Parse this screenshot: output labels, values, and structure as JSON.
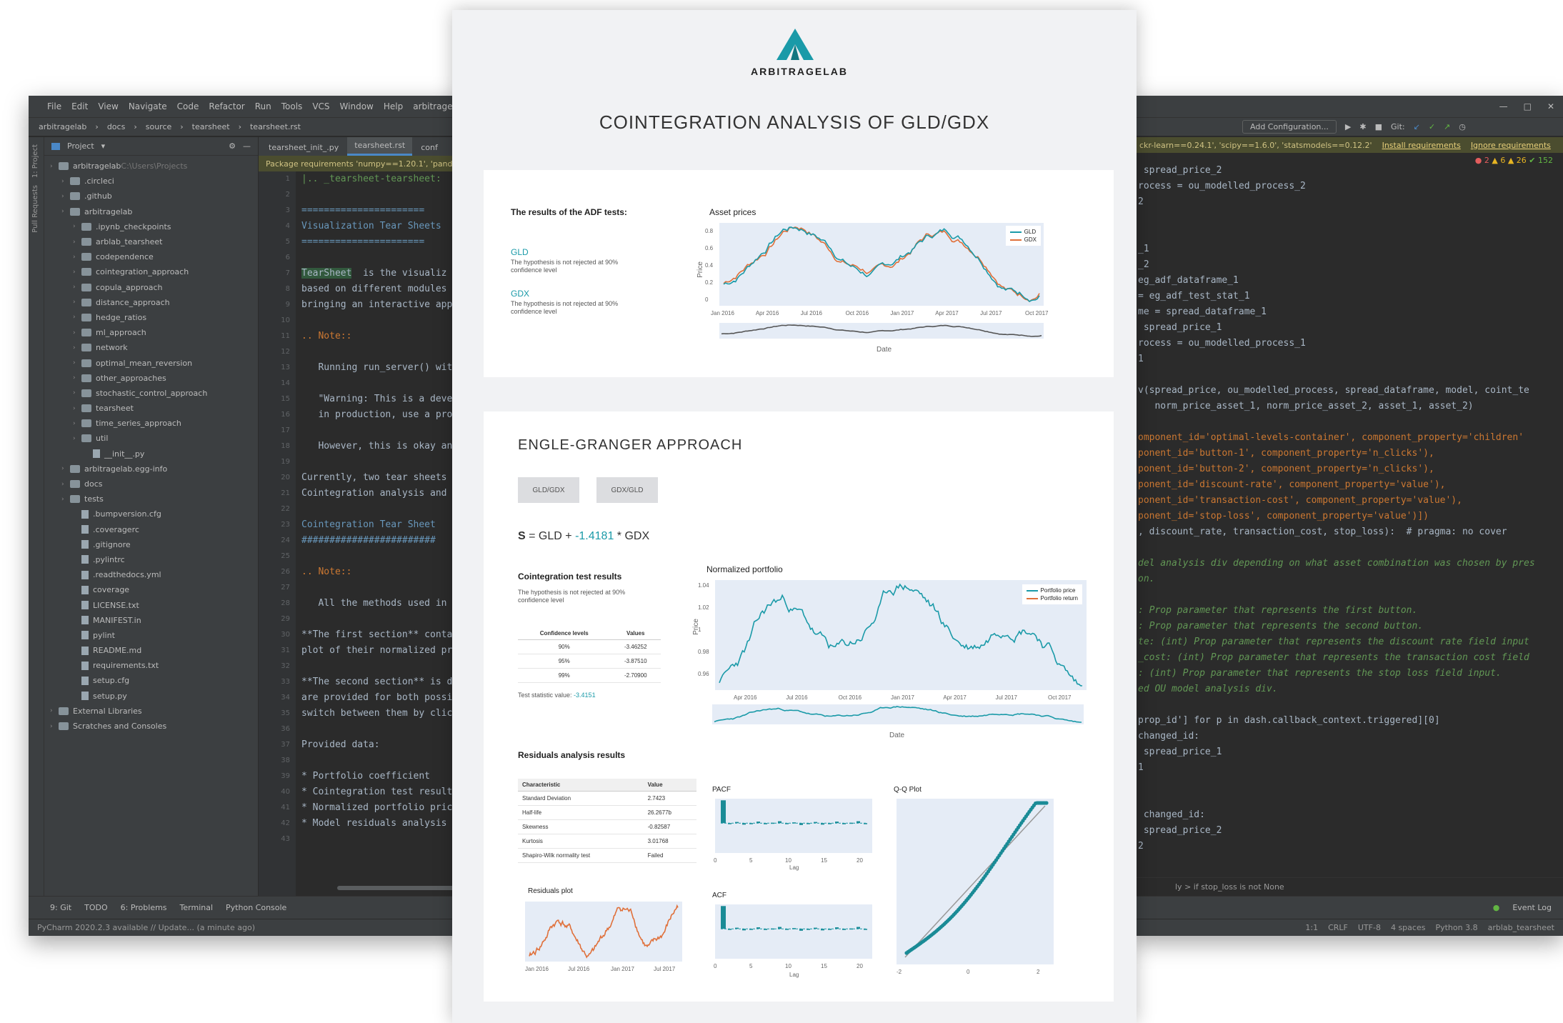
{
  "ide_left": {
    "menu": [
      "File",
      "Edit",
      "View",
      "Navigate",
      "Code",
      "Refactor",
      "Run",
      "Tools",
      "VCS",
      "Window",
      "Help",
      "arbitragelab"
    ],
    "breadcrumbs": [
      "arbitragelab",
      "docs",
      "source",
      "tearsheet",
      "tearsheet.rst"
    ],
    "project_header": "Project",
    "tree": [
      {
        "label": "arbitragelab",
        "kind": "folder",
        "depth": 0,
        "suffix": "C:\\Users\\Projects"
      },
      {
        "label": ".circleci",
        "kind": "folder",
        "depth": 1
      },
      {
        "label": ".github",
        "kind": "folder",
        "depth": 1
      },
      {
        "label": "arbitragelab",
        "kind": "folder",
        "depth": 1
      },
      {
        "label": ".ipynb_checkpoints",
        "kind": "folder",
        "depth": 2
      },
      {
        "label": "arblab_tearsheet",
        "kind": "folder",
        "depth": 2
      },
      {
        "label": "codependence",
        "kind": "folder",
        "depth": 2
      },
      {
        "label": "cointegration_approach",
        "kind": "folder",
        "depth": 2
      },
      {
        "label": "copula_approach",
        "kind": "folder",
        "depth": 2
      },
      {
        "label": "distance_approach",
        "kind": "folder",
        "depth": 2
      },
      {
        "label": "hedge_ratios",
        "kind": "folder",
        "depth": 2
      },
      {
        "label": "ml_approach",
        "kind": "folder",
        "depth": 2
      },
      {
        "label": "network",
        "kind": "folder",
        "depth": 2
      },
      {
        "label": "optimal_mean_reversion",
        "kind": "folder",
        "depth": 2
      },
      {
        "label": "other_approaches",
        "kind": "folder",
        "depth": 2
      },
      {
        "label": "stochastic_control_approach",
        "kind": "folder",
        "depth": 2
      },
      {
        "label": "tearsheet",
        "kind": "folder",
        "depth": 2
      },
      {
        "label": "time_series_approach",
        "kind": "folder",
        "depth": 2
      },
      {
        "label": "util",
        "kind": "folder",
        "depth": 2
      },
      {
        "label": "__init__.py",
        "kind": "file",
        "depth": 3
      },
      {
        "label": "arbitragelab.egg-info",
        "kind": "folder",
        "depth": 1
      },
      {
        "label": "docs",
        "kind": "folder",
        "depth": 1
      },
      {
        "label": "tests",
        "kind": "folder",
        "depth": 1
      },
      {
        "label": ".bumpversion.cfg",
        "kind": "file",
        "depth": 2
      },
      {
        "label": ".coveragerc",
        "kind": "file",
        "depth": 2
      },
      {
        "label": ".gitignore",
        "kind": "file",
        "depth": 2
      },
      {
        "label": ".pylintrc",
        "kind": "file",
        "depth": 2
      },
      {
        "label": ".readthedocs.yml",
        "kind": "file",
        "depth": 2
      },
      {
        "label": "coverage",
        "kind": "file",
        "depth": 2
      },
      {
        "label": "LICENSE.txt",
        "kind": "file",
        "depth": 2
      },
      {
        "label": "MANIFEST.in",
        "kind": "file",
        "depth": 2
      },
      {
        "label": "pylint",
        "kind": "file",
        "depth": 2
      },
      {
        "label": "README.md",
        "kind": "file",
        "depth": 2
      },
      {
        "label": "requirements.txt",
        "kind": "file",
        "depth": 2
      },
      {
        "label": "setup.cfg",
        "kind": "file",
        "depth": 2
      },
      {
        "label": "setup.py",
        "kind": "file",
        "depth": 2
      },
      {
        "label": "External Libraries",
        "kind": "folder",
        "depth": 0
      },
      {
        "label": "Scratches and Consoles",
        "kind": "folder",
        "depth": 0
      }
    ],
    "tabs": [
      "tearsheet_init_.py",
      "tearsheet.rst",
      "conf"
    ],
    "warning": "Package requirements 'numpy==1.20.1', 'pandas==1",
    "line_numbers": [
      "1",
      "2",
      "3",
      "4",
      "5",
      "6",
      "7",
      "8",
      "9",
      "10",
      "11",
      "12",
      "13",
      "14",
      "15",
      "16",
      "17",
      "18",
      "19",
      "20",
      "21",
      "22",
      "23",
      "24",
      "25",
      "26",
      "27",
      "28",
      "29",
      "30",
      "31",
      "32",
      "33",
      "34",
      "35",
      "36",
      "37",
      "38",
      "39",
      "40",
      "41",
      "42",
      "43"
    ],
    "code": [
      {
        "t": "|.. _tearsheet-tearsheet:",
        "c": "c-head"
      },
      {
        "t": "",
        "c": "c-gray"
      },
      {
        "t": "======================",
        "c": "c-blue"
      },
      {
        "t": "Visualization Tear Sheets",
        "c": "c-blue"
      },
      {
        "t": "======================",
        "c": "c-blue"
      },
      {
        "t": "",
        "c": "c-gray"
      },
      {
        "t": "TearSheet  is the visualiz",
        "c": "c-gray"
      },
      {
        "t": "based on different modules ",
        "c": "c-gray"
      },
      {
        "t": "bringing an interactive app",
        "c": "c-gray"
      },
      {
        "t": "",
        "c": "c-gray"
      },
      {
        "t": ".. Note::",
        "c": "c-key"
      },
      {
        "t": "",
        "c": "c-gray"
      },
      {
        "t": "   Running run_server() wit",
        "c": "c-gray"
      },
      {
        "t": "",
        "c": "c-gray"
      },
      {
        "t": "   \"Warning: This is a deve",
        "c": "c-gray"
      },
      {
        "t": "   in production, use a pro",
        "c": "c-gray"
      },
      {
        "t": "",
        "c": "c-gray"
      },
      {
        "t": "   However, this is okay an",
        "c": "c-gray"
      },
      {
        "t": "",
        "c": "c-gray"
      },
      {
        "t": "Currently, two tear sheets a",
        "c": "c-gray"
      },
      {
        "t": "Cointegration analysis and O",
        "c": "c-gray"
      },
      {
        "t": "",
        "c": "c-gray"
      },
      {
        "t": "Cointegration Tear Sheet",
        "c": "c-blue"
      },
      {
        "t": "########################",
        "c": "c-blue"
      },
      {
        "t": "",
        "c": "c-gray"
      },
      {
        "t": ".. Note::",
        "c": "c-key"
      },
      {
        "t": "",
        "c": "c-gray"
      },
      {
        "t": "   All the methods used in ",
        "c": "c-gray"
      },
      {
        "t": "",
        "c": "c-gray"
      },
      {
        "t": "**The first section** conta",
        "c": "c-gray"
      },
      {
        "t": "plot of their normalized pri",
        "c": "c-gray"
      },
      {
        "t": "",
        "c": "c-gray"
      },
      {
        "t": "**The second section** is de",
        "c": "c-gray"
      },
      {
        "t": "are provided for both possib",
        "c": "c-gray"
      },
      {
        "t": "switch between them by click",
        "c": "c-gray"
      },
      {
        "t": "",
        "c": "c-gray"
      },
      {
        "t": "Provided data:",
        "c": "c-gray"
      },
      {
        "t": "",
        "c": "c-gray"
      },
      {
        "t": "* Portfolio coefficient",
        "c": "c-gray"
      },
      {
        "t": "* Cointegration test results",
        "c": "c-gray"
      },
      {
        "t": "* Normalized portfolio price",
        "c": "c-gray"
      },
      {
        "t": "* Model residuals analysis",
        "c": "c-gray"
      },
      {
        "t": "",
        "c": "c-gray"
      }
    ],
    "toolwindows": [
      "9: Git",
      "TODO",
      "6: Problems",
      "Terminal",
      "Python Console"
    ],
    "status": "PyCharm 2020.2.3 available // Update... (a minute ago)"
  },
  "ide_right": {
    "toolbar_config": "Add Configuration...",
    "toolbar_git": "Git:",
    "warning": "ckr-learn==0.24.1', 'scipy==1.6.0', 'statsmodels==0.12.2'",
    "warning_link1": "Install requirements",
    "warning_link2": "Ignore requirements",
    "inspections": {
      "errors": "2",
      "warnings": "6",
      "weak": "26",
      "ok": "152"
    },
    "code": [
      {
        "t": " spread_price_2",
        "c": "c-gray"
      },
      {
        "t": "rocess = ou_modelled_process_2",
        "c": "c-gray"
      },
      {
        "t": "2",
        "c": "c-gray"
      },
      {
        "t": "",
        "c": "c-gray"
      },
      {
        "t": "",
        "c": "c-gray"
      },
      {
        "t": "_1",
        "c": "c-gray"
      },
      {
        "t": "_2",
        "c": "c-gray"
      },
      {
        "t": "eg_adf_dataframe_1",
        "c": "c-gray"
      },
      {
        "t": "= eg_adf_test_stat_1",
        "c": "c-gray"
      },
      {
        "t": "me = spread_dataframe_1",
        "c": "c-gray"
      },
      {
        "t": " spread_price_1",
        "c": "c-gray"
      },
      {
        "t": "rocess = ou_modelled_process_1",
        "c": "c-gray"
      },
      {
        "t": "1",
        "c": "c-gray"
      },
      {
        "t": "",
        "c": "c-gray"
      },
      {
        "t": "v(spread_price, ou_modelled_process, spread_dataframe, model, coint_te",
        "c": "c-gray"
      },
      {
        "t": "   norm_price_asset_1, norm_price_asset_2, asset_1, asset_2)",
        "c": "c-gray"
      },
      {
        "t": "",
        "c": "c-gray"
      },
      {
        "t": "omponent_id='optimal-levels-container', component_property='children'",
        "c": "c-key"
      },
      {
        "t": "ponent_id='button-1', component_property='n_clicks'),",
        "c": "c-key"
      },
      {
        "t": "ponent_id='button-2', component_property='n_clicks'),",
        "c": "c-key"
      },
      {
        "t": "ponent_id='discount-rate', component_property='value'),",
        "c": "c-key"
      },
      {
        "t": "ponent_id='transaction-cost', component_property='value'),",
        "c": "c-key"
      },
      {
        "t": "ponent_id='stop-loss', component_property='value')])",
        "c": "c-key"
      },
      {
        "t": ", discount_rate, transaction_cost, stop_loss):  # pragma: no cover",
        "c": "c-gray"
      },
      {
        "t": "",
        "c": "c-gray"
      },
      {
        "t": "del analysis div depending on what asset combination was chosen by pres",
        "c": "c-com"
      },
      {
        "t": "on.",
        "c": "c-com"
      },
      {
        "t": "",
        "c": "c-gray"
      },
      {
        "t": ": Prop parameter that represents the first button.",
        "c": "c-com"
      },
      {
        "t": ": Prop parameter that represents the second button.",
        "c": "c-com"
      },
      {
        "t": "te: (int) Prop parameter that represents the discount rate field input",
        "c": "c-com"
      },
      {
        "t": "_cost: (int) Prop parameter that represents the transaction cost field",
        "c": "c-com"
      },
      {
        "t": ": (int) Prop parameter that represents the stop loss field input.",
        "c": "c-com"
      },
      {
        "t": "ed OU model analysis div.",
        "c": "c-com"
      },
      {
        "t": "",
        "c": "c-gray"
      },
      {
        "t": "prop_id'] for p in dash.callback_context.triggered][0]",
        "c": "c-gray"
      },
      {
        "t": "changed_id:",
        "c": "c-gray"
      },
      {
        "t": " spread_price_1",
        "c": "c-gray"
      },
      {
        "t": "1",
        "c": "c-gray"
      },
      {
        "t": "",
        "c": "c-gray"
      },
      {
        "t": "",
        "c": "c-gray"
      },
      {
        "t": " changed_id:",
        "c": "c-gray"
      },
      {
        "t": " spread_price_2",
        "c": "c-gray"
      },
      {
        "t": "2",
        "c": "c-gray"
      }
    ],
    "crumb": "ly  >  if stop_loss is not None",
    "event_log": "Event Log",
    "status": [
      "1:1",
      "CRLF",
      "UTF-8",
      "4 spaces",
      "Python 3.8",
      "arblab_tearsheet"
    ]
  },
  "sheet": {
    "brand": "ARBITRAGELAB",
    "title": "COINTEGRATION ANALYSIS OF GLD/GDX",
    "adf": {
      "heading": "The results of the ADF tests:",
      "gld_label": "GLD",
      "gld_text": "The hypothesis is not rejected at 90% confidence level",
      "gdx_label": "GDX",
      "gdx_text": "The hypothesis is not rejected at 90% confidence level"
    },
    "asset_prices": {
      "title": "Asset prices",
      "ylabel": "Price",
      "xlabel": "Date",
      "xticks": [
        "Jan 2016",
        "Apr 2016",
        "Jul 2016",
        "Oct 2016",
        "Jan 2017",
        "Apr 2017",
        "Jul 2017",
        "Oct 2017"
      ],
      "yticks": [
        "0.8",
        "0.6",
        "0.4",
        "0.2",
        "0"
      ],
      "legend": [
        "GLD",
        "GDX"
      ],
      "colors": [
        "#1a9aa8",
        "#e0703a"
      ]
    },
    "engle": {
      "title": "ENGLE-GRANGER APPROACH",
      "btn1": "GLD/GDX",
      "btn2": "GDX/GLD",
      "eq_s": "S",
      "eq_eq": "=",
      "eq_asset1": "GLD",
      "eq_plus": "+",
      "eq_coef": "-1.4181",
      "eq_asset2": "* GDX"
    },
    "coint_test": {
      "heading": "Cointegration test results",
      "text": "The hypothesis is not rejected at 90% confidence level",
      "col1": "Confidence levels",
      "col2": "Values",
      "rows": [
        [
          "90%",
          "-3.46252"
        ],
        [
          "95%",
          "-3.87510"
        ],
        [
          "99%",
          "-2.70900"
        ]
      ],
      "stat_label": "Test statistic value:",
      "stat_value": "-3.4151"
    },
    "norm_portfolio": {
      "title": "Normalized portfolio",
      "ylabel": "Price",
      "xlabel": "Date",
      "xticks": [
        "Apr 2016",
        "Jul 2016",
        "Oct 2016",
        "Jan 2017",
        "Apr 2017",
        "Jul 2017",
        "Oct 2017"
      ],
      "yticks": [
        "1.04",
        "1.02",
        "1",
        "0.98",
        "0.96"
      ],
      "legend": [
        "Portfolio price",
        "Portfolio return"
      ]
    },
    "residuals": {
      "heading": "Residuals analysis results",
      "col1": "Characteristic",
      "col2": "Value",
      "rows": [
        [
          "Standard Deviation",
          "2.7423"
        ],
        [
          "Half-life",
          "26.2677b"
        ],
        [
          "Skewness",
          "-0.82587"
        ],
        [
          "Kurtosis",
          "3.01768"
        ],
        [
          "Shapiro-Wilk normality test",
          "Failed"
        ]
      ],
      "plot_title": "Residuals plot",
      "xticks": [
        "Jan 2016",
        "Jul 2016",
        "Jan 2017",
        "Jul 2017"
      ]
    },
    "pacf": {
      "title": "PACF",
      "xlabel": "Lag",
      "xticks": [
        "0",
        "5",
        "10",
        "15",
        "20"
      ]
    },
    "acf": {
      "title": "ACF",
      "xlabel": "Lag",
      "xticks": [
        "0",
        "5",
        "10",
        "15",
        "20"
      ]
    },
    "qq": {
      "title": "Q-Q Plot",
      "xticks": [
        "-2",
        "0",
        "2"
      ]
    }
  }
}
